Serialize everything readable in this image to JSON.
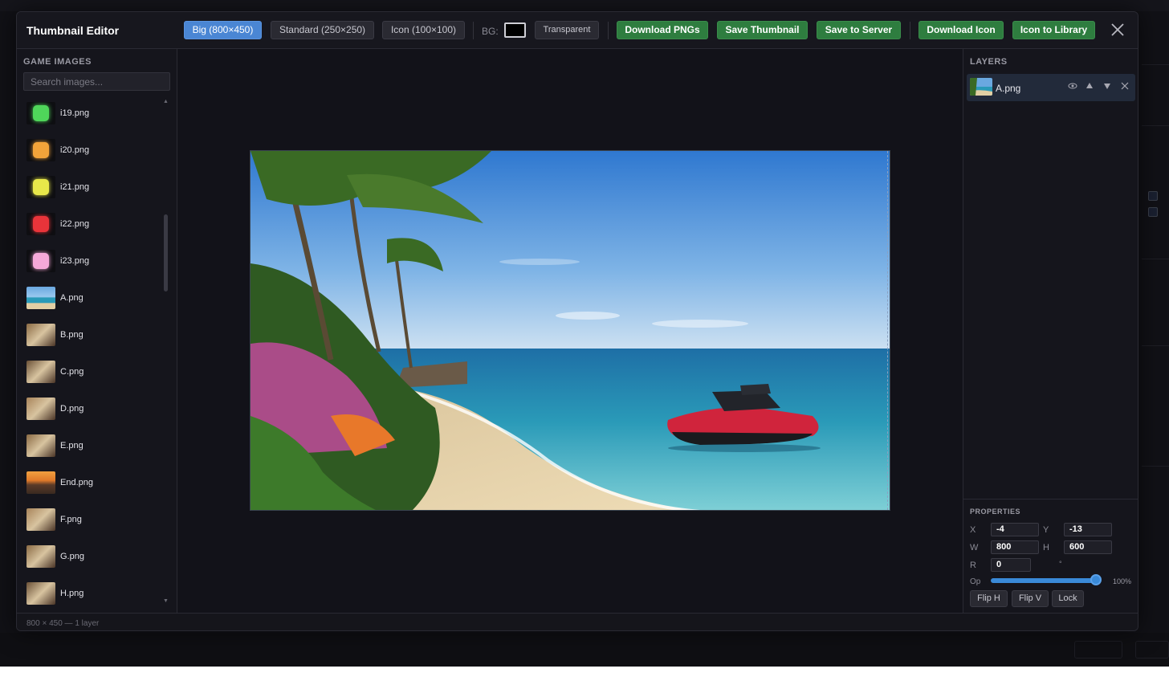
{
  "header": {
    "title": "Thumbnail Editor",
    "size_buttons": [
      {
        "label": "Big (800×450)",
        "active": true
      },
      {
        "label": "Standard (250×250)",
        "active": false
      },
      {
        "label": "Icon (100×100)",
        "active": false
      }
    ],
    "bg_label": "BG:",
    "bg_color": "#000000",
    "transparent_label": "Transparent",
    "action_buttons": [
      "Download PNGs",
      "Save Thumbnail",
      "Save to Server",
      "Download Icon",
      "Icon to Library"
    ]
  },
  "left": {
    "section_title": "GAME IMAGES",
    "search_placeholder": "Search images...",
    "items": [
      {
        "label": "i19.png",
        "kind": "gem",
        "color": "#4fd65a"
      },
      {
        "label": "i20.png",
        "kind": "gem",
        "color": "#f2a33a"
      },
      {
        "label": "i21.png",
        "kind": "gem",
        "color": "#e8e84a"
      },
      {
        "label": "i22.png",
        "kind": "gem",
        "color": "#e8343a"
      },
      {
        "label": "i23.png",
        "kind": "gem",
        "color": "#f5a8d8"
      },
      {
        "label": "A.png",
        "kind": "beach"
      },
      {
        "label": "B.png",
        "kind": "room"
      },
      {
        "label": "C.png",
        "kind": "room"
      },
      {
        "label": "D.png",
        "kind": "room"
      },
      {
        "label": "E.png",
        "kind": "room"
      },
      {
        "label": "End.png",
        "kind": "sunset"
      },
      {
        "label": "F.png",
        "kind": "room"
      },
      {
        "label": "G.png",
        "kind": "room"
      },
      {
        "label": "H.png",
        "kind": "room"
      }
    ]
  },
  "layers": {
    "section_title": "LAYERS",
    "items": [
      {
        "label": "A.png"
      }
    ]
  },
  "properties": {
    "section_title": "PROPERTIES",
    "x_label": "X",
    "x": "-4",
    "y_label": "Y",
    "y": "-13",
    "w_label": "W",
    "w": "800",
    "h_label": "H",
    "h": "600",
    "r_label": "R",
    "r": "0",
    "deg": "°",
    "op_label": "Op",
    "opacity": "100%",
    "flip_h": "Flip H",
    "flip_v": "Flip V",
    "lock": "Lock"
  },
  "footer": {
    "status": "800 × 450 — 1 layer"
  }
}
